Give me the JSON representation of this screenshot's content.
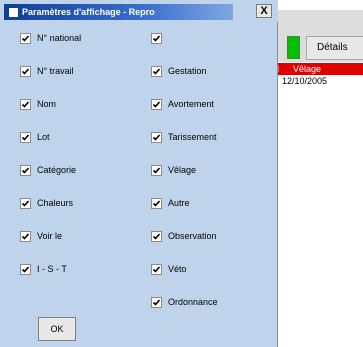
{
  "dialog": {
    "title": "Paramètres d'affichage - Repro",
    "close_label": "X",
    "ok_label": "OK",
    "left_items": [
      {
        "label": "N° national",
        "checked": true
      },
      {
        "label": "N° travail",
        "checked": true
      },
      {
        "label": "Nom",
        "checked": true
      },
      {
        "label": "Lot",
        "checked": true
      },
      {
        "label": "Catégorie",
        "checked": true
      },
      {
        "label": "Chaleurs",
        "checked": true
      },
      {
        "label": "Voir le",
        "checked": true
      },
      {
        "label": "I - S - T",
        "checked": true
      }
    ],
    "right_items": [
      {
        "label": "",
        "checked": true
      },
      {
        "label": "Gestation",
        "checked": true
      },
      {
        "label": "Avortement",
        "checked": true
      },
      {
        "label": "Tarissement",
        "checked": true
      },
      {
        "label": "Vêlage",
        "checked": true
      },
      {
        "label": "Autre",
        "checked": true
      },
      {
        "label": "Observation",
        "checked": true
      },
      {
        "label": "Véto",
        "checked": true
      },
      {
        "label": "Ordonnance",
        "checked": true
      }
    ]
  },
  "background": {
    "details_label": "Détails",
    "selected_row_lead": "l",
    "selected_row_text": "Vêlage",
    "row_date": "12/10/2005"
  },
  "colors": {
    "dialog_bg": "#bfd4ea",
    "title_bar": "#0d3f9a",
    "selected_row": "#e00000",
    "indicator": "#00c000"
  }
}
